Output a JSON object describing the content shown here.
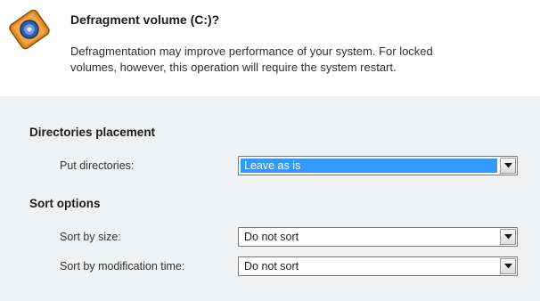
{
  "header": {
    "title": "Defragment volume (C:)?",
    "description_line1": "Defragmentation may improve performance of your system. For locked",
    "description_line2": "volumes, however, this operation will require the system restart.",
    "icon": "disk-defrag-icon"
  },
  "directories_placement": {
    "heading": "Directories placement",
    "put_directories_label": "Put directories:",
    "put_directories_value": "Leave as is"
  },
  "sort_options": {
    "heading": "Sort options",
    "sort_by_size_label": "Sort by size:",
    "sort_by_size_value": "Do not sort",
    "sort_by_modification_label": "Sort by modification time:",
    "sort_by_modification_value": "Do not sort"
  },
  "colors": {
    "selection": "#3399ff",
    "panel_background": "#eff1f3",
    "icon_orange": "#e38a1e"
  }
}
